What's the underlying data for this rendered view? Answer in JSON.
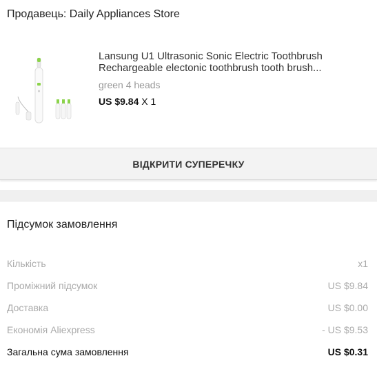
{
  "seller": {
    "label": "Продавець: Daily Appliances Store"
  },
  "product": {
    "title_line1": "Lansung U1 Ultrasonic Sonic Electric Toothbrush",
    "title_line2": "Rechargeable electonic toothbrush tooth brush...",
    "variant": "green 4 heads",
    "price": "US $9.84",
    "quantity": "X 1"
  },
  "actions": {
    "dispute_label": "ВІДКРИТИ СУПЕРЕЧКУ"
  },
  "summary": {
    "title": "Підсумок замовлення",
    "rows": [
      {
        "label": "Кількість",
        "value": "x1"
      },
      {
        "label": "Проміжний підсумок",
        "value": "US $9.84"
      },
      {
        "label": "Доставка",
        "value": "US $0.00"
      },
      {
        "label": "Економія Aliexpress",
        "value": "- US $9.53"
      }
    ],
    "total": {
      "label": "Загальна сума замовлення",
      "value": "US $0.31"
    }
  },
  "colors": {
    "accent_green": "#8bd34a",
    "muted_text": "#aaaaaa"
  }
}
